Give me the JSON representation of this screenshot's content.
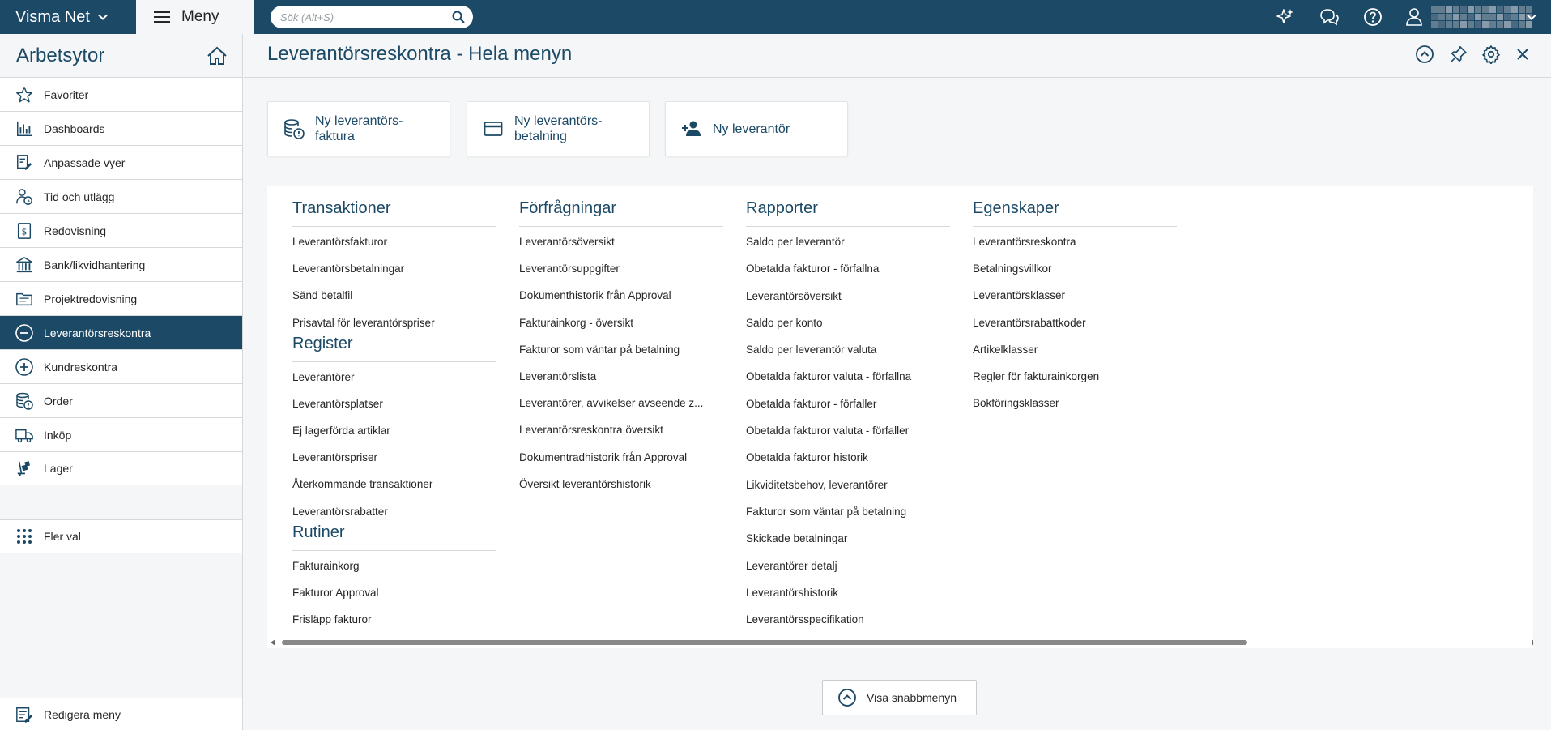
{
  "topbar": {
    "brand": "Visma Net",
    "menu_label": "Meny",
    "search_placeholder": "Sök (Alt+S)"
  },
  "sidebar": {
    "title": "Arbetsytor",
    "items": [
      {
        "label": "Favoriter",
        "icon": "star-icon"
      },
      {
        "label": "Dashboards",
        "icon": "bar-chart-icon"
      },
      {
        "label": "Anpassade vyer",
        "icon": "custom-view-icon"
      },
      {
        "label": "Tid och utlägg",
        "icon": "time-expense-icon"
      },
      {
        "label": "Redovisning",
        "icon": "ledger-icon"
      },
      {
        "label": "Bank/likvidhantering",
        "icon": "bank-icon"
      },
      {
        "label": "Projektredovisning",
        "icon": "project-folder-icon"
      },
      {
        "label": "Leverantörsreskontra",
        "icon": "minus-circle-icon"
      },
      {
        "label": "Kundreskontra",
        "icon": "plus-circle-icon"
      },
      {
        "label": "Order",
        "icon": "order-icon"
      },
      {
        "label": "Inköp",
        "icon": "truck-icon"
      },
      {
        "label": "Lager",
        "icon": "warehouse-icon"
      }
    ],
    "active_index": 7,
    "more_label": "Fler val",
    "edit_label": "Redigera meny"
  },
  "main": {
    "title": "Leverantörsreskontra - Hela menyn",
    "tiles": [
      {
        "label": "Ny leverantörs-\nfaktura",
        "icon": "invoice-icon"
      },
      {
        "label": "Ny leverantörs-\nbetalning",
        "icon": "card-icon"
      },
      {
        "label": "Ny leverantör",
        "icon": "add-person-icon"
      }
    ],
    "columns": [
      {
        "sections": [
          {
            "title": "Transaktioner",
            "links": [
              "Leverantörsfakturor",
              "Leverantörsbetalningar",
              "Sänd betalfil",
              "Prisavtal för leverantörspriser"
            ]
          },
          {
            "title": "Register",
            "links": [
              "Leverantörer",
              "Leverantörsplatser",
              "Ej lagerförda artiklar",
              "Leverantörspriser",
              "Återkommande transaktioner",
              "Leverantörsrabatter"
            ]
          },
          {
            "title": "Rutiner",
            "links": [
              "Fakturainkorg",
              "Fakturor Approval",
              "Frisläpp fakturor"
            ]
          }
        ]
      },
      {
        "sections": [
          {
            "title": "Förfrågningar",
            "links": [
              "Leverantörsöversikt",
              "Leverantörsuppgifter",
              "Dokumenthistorik från Approval",
              "Fakturainkorg - översikt",
              "Fakturor som väntar på betalning",
              "Leverantörslista",
              "Leverantörer, avvikelser avseende z...",
              "Leverantörsreskontra översikt",
              "Dokumentradhistorik från Approval",
              "Översikt leverantörshistorik"
            ]
          }
        ]
      },
      {
        "sections": [
          {
            "title": "Rapporter",
            "links": [
              "Saldo per leverantör",
              "Obetalda fakturor - förfallna",
              "Leverantörsöversikt",
              "Saldo per konto",
              "Saldo per leverantör valuta",
              "Obetalda fakturor valuta - förfallna",
              "Obetalda fakturor - förfaller",
              "Obetalda fakturor valuta - förfaller",
              "Obetalda fakturor historik",
              "Likviditetsbehov, leverantörer",
              "Fakturor som väntar på betalning",
              "Skickade betalningar",
              "Leverantörer detalj",
              "Leverantörshistorik",
              "Leverantörsspecifikation"
            ]
          }
        ]
      },
      {
        "sections": [
          {
            "title": "Egenskaper",
            "links": [
              "Leverantörsreskontra",
              "Betalningsvillkor",
              "Leverantörsklasser",
              "Leverantörsrabattkoder",
              "Artikelklasser",
              "Regler för fakturainkorgen",
              "Bokföringsklasser"
            ]
          }
        ]
      }
    ],
    "quick_menu_label": "Visa snabbmenyn"
  },
  "colors": {
    "brand": "#1b4966",
    "background": "#f5f6f7",
    "panel": "#ffffff"
  }
}
